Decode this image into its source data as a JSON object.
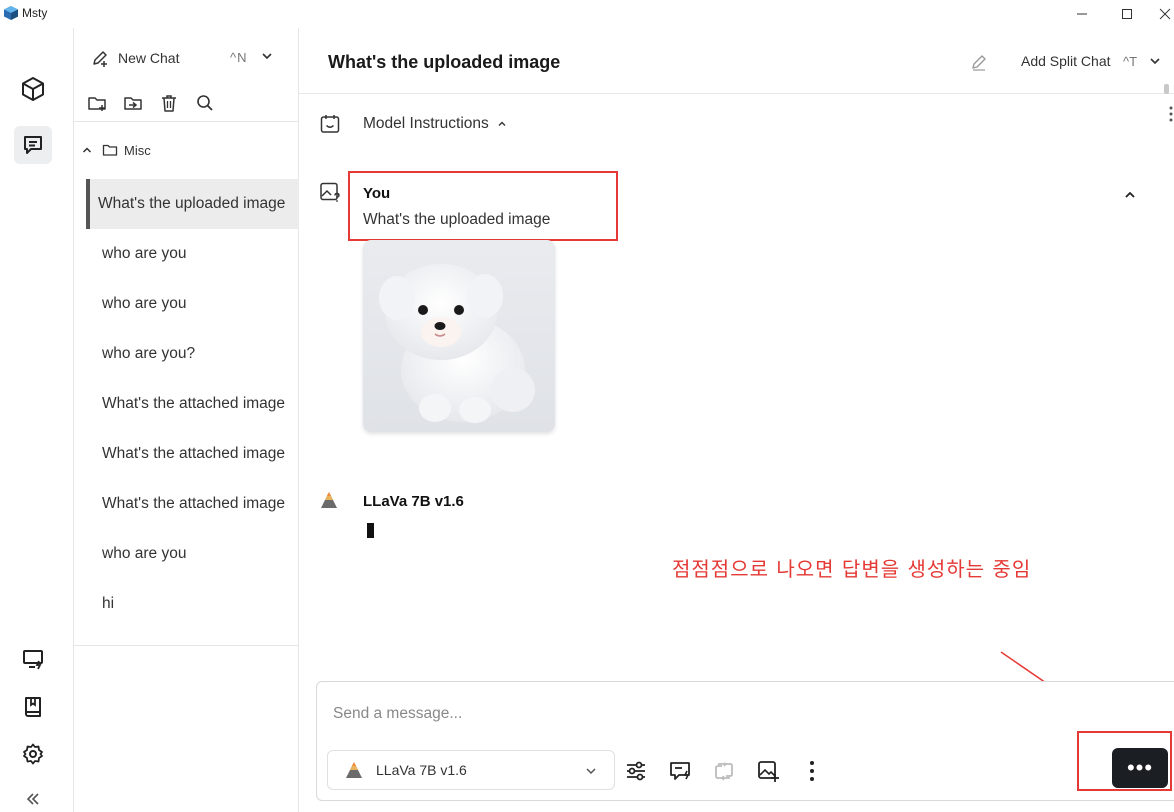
{
  "window": {
    "title": "Msty"
  },
  "sidebar": {
    "new_chat_label": "New Chat",
    "new_chat_shortcut": "^N",
    "folder_name": "Misc",
    "chats": [
      {
        "label": "What's the uploaded image",
        "selected": true
      },
      {
        "label": "who are you",
        "selected": false
      },
      {
        "label": "who are you",
        "selected": false
      },
      {
        "label": "who are you?",
        "selected": false
      },
      {
        "label": "What's the attached image",
        "selected": false
      },
      {
        "label": "What's the attached image",
        "selected": false
      },
      {
        "label": "What's the attached image",
        "selected": false
      },
      {
        "label": "who are you",
        "selected": false
      },
      {
        "label": "hi",
        "selected": false
      }
    ]
  },
  "header": {
    "title": "What's the uploaded image",
    "split_chat_label": "Add Split Chat",
    "split_chat_shortcut": "^T"
  },
  "conversation": {
    "model_instructions_label": "Model Instructions",
    "user_name": "You",
    "user_message": "What's the uploaded image",
    "bot_name": "LLaVa 7B v1.6"
  },
  "annotation": {
    "text": "점점점으로 나오면 답변을 생성하는 중임",
    "color": "#e53935"
  },
  "composer": {
    "placeholder": "Send a message...",
    "model_name": "LLaVa 7B v1.6",
    "stop_label": "•••"
  },
  "colors": {
    "highlight_red": "#e53935",
    "send_button_bg": "#1b1f24",
    "selected_chat_bg": "#ececec"
  }
}
